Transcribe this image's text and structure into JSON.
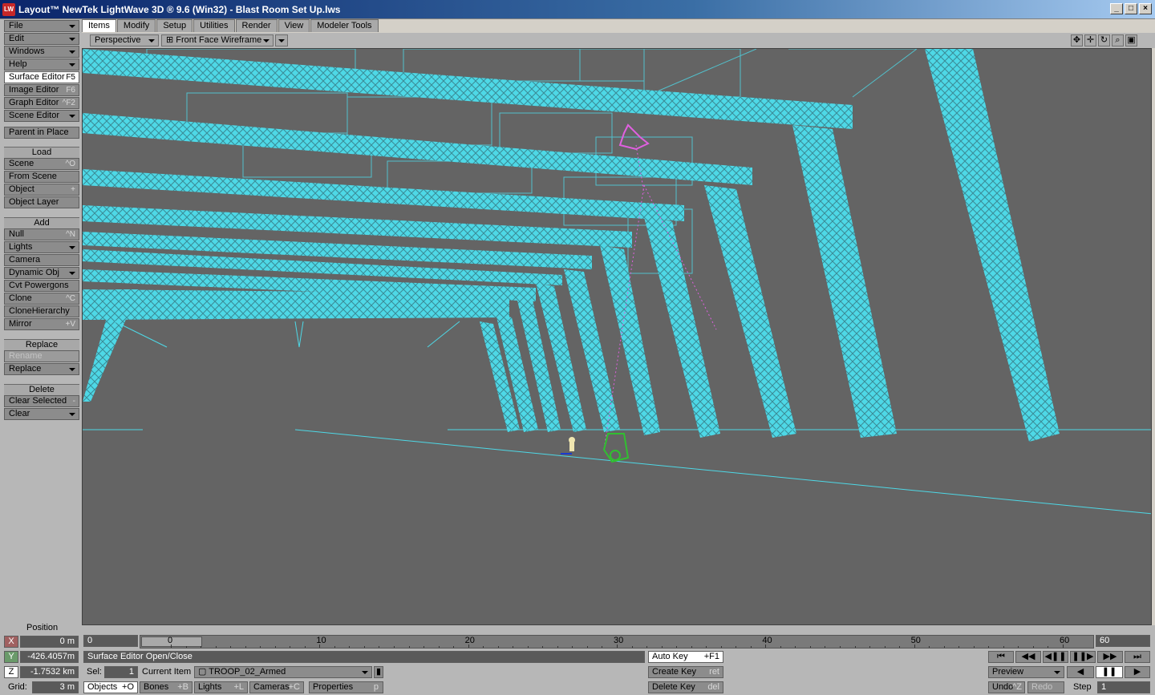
{
  "window": {
    "title": "Layout™ NewTek LightWave 3D ® 9.6  (Win32) - Blast Room Set Up.lws",
    "logo": "LW"
  },
  "menu": [
    {
      "label": "File",
      "dropdown": true
    },
    {
      "label": "Edit",
      "dropdown": true
    },
    {
      "label": "Windows",
      "dropdown": true
    },
    {
      "label": "Help",
      "dropdown": true
    },
    {
      "label": "Surface Editor",
      "shortcut": "F5",
      "active": true
    },
    {
      "label": "Image Editor",
      "shortcut": "F6"
    },
    {
      "label": "Graph Editor",
      "shortcut": "^F2"
    },
    {
      "label": "Scene Editor",
      "dropdown": true
    }
  ],
  "parent_in_place": "Parent in Place",
  "load": {
    "header": "Load",
    "items": [
      {
        "label": "Scene",
        "shortcut": "^O"
      },
      {
        "label": "From Scene",
        "shortcut": ""
      },
      {
        "label": "Object",
        "shortcut": "+"
      },
      {
        "label": "Object Layer",
        "shortcut": ""
      }
    ]
  },
  "add": {
    "header": "Add",
    "items": [
      {
        "label": "Null",
        "shortcut": "^N"
      },
      {
        "label": "Lights",
        "dropdown": true
      },
      {
        "label": "Camera",
        "shortcut": ""
      },
      {
        "label": "Dynamic Obj",
        "dropdown": true
      },
      {
        "label": "Cvt Powergons",
        "shortcut": ""
      },
      {
        "label": "Clone",
        "shortcut": "^C"
      },
      {
        "label": "CloneHierarchy",
        "shortcut": ""
      },
      {
        "label": "Mirror",
        "shortcut": "+V"
      }
    ]
  },
  "replace": {
    "header": "Replace",
    "items": [
      {
        "label": "Rename",
        "disabled": true
      },
      {
        "label": "Replace",
        "dropdown": true
      }
    ]
  },
  "delete": {
    "header": "Delete",
    "items": [
      {
        "label": "Clear Selected",
        "shortcut": "-"
      },
      {
        "label": "Clear",
        "dropdown": true
      }
    ]
  },
  "tabs": [
    "Items",
    "Modify",
    "Setup",
    "Utilities",
    "Render",
    "View",
    "Modeler Tools"
  ],
  "active_tab": "Items",
  "viewport": {
    "view_mode": "Perspective",
    "render_mode": "⊞ Front Face Wireframe"
  },
  "position": {
    "label": "Position",
    "x_label": "X",
    "x": "0 m",
    "y_label": "Y",
    "y": "-426.4057m",
    "z_label": "Z",
    "z": "-1.7532 km",
    "grid_label": "Grid:",
    "grid": "3 m"
  },
  "timeline": {
    "start": "0",
    "end": "60",
    "current": "0",
    "ticks": [
      "0",
      "10",
      "20",
      "30",
      "40",
      "50",
      "60"
    ]
  },
  "status": {
    "message": "Surface Editor Open/Close",
    "sel_label": "Sel:",
    "sel": "1",
    "current_item_label": "Current Item",
    "current_item": "TROOP_02_Armed"
  },
  "item_types": [
    {
      "label": "Objects",
      "shortcut": "+O",
      "active": true
    },
    {
      "label": "Bones",
      "shortcut": "+B"
    },
    {
      "label": "Lights",
      "shortcut": "+L"
    },
    {
      "label": "Cameras",
      "shortcut": "+C"
    }
  ],
  "properties": {
    "label": "Properties",
    "shortcut": "p"
  },
  "keys": {
    "auto_key": "Auto Key",
    "auto_key_sc": "+F1",
    "create_key": "Create Key",
    "create_key_sc": "ret",
    "delete_key": "Delete Key",
    "delete_key_sc": "del"
  },
  "playback": {
    "preview": "Preview",
    "undo": "Undo",
    "undo_sc": "^Z",
    "redo": "Redo",
    "step_label": "Step",
    "step": "1",
    "transport_icons": [
      "⏮",
      "◀◀",
      "◀❚❚",
      "❚❚▶",
      "▶▶",
      "⏭"
    ]
  },
  "colors": {
    "wire": "#4ed8e6",
    "viewport_bg": "#646464",
    "selected": "#e060e0",
    "camera": "#30c030"
  }
}
